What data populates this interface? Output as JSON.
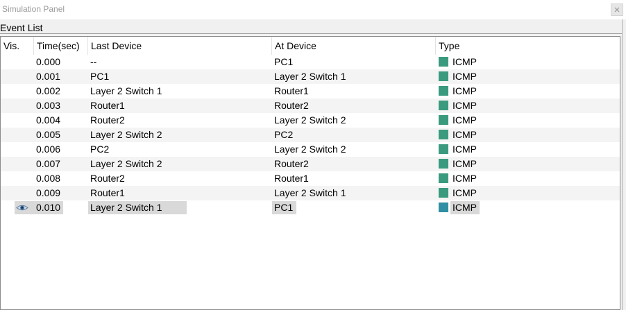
{
  "window": {
    "title": "Simulation Panel",
    "close_icon": "close-icon"
  },
  "event_list": {
    "label": "Event List",
    "columns": [
      "Vis.",
      "Time(sec)",
      "Last Device",
      "At Device",
      "Type"
    ],
    "rows": [
      {
        "time": "0.000",
        "last": "--",
        "at": "PC1",
        "type": "ICMP",
        "color": "#3a9a7e"
      },
      {
        "time": "0.001",
        "last": "PC1",
        "at": "Layer 2 Switch 1",
        "type": "ICMP",
        "color": "#3a9a7e"
      },
      {
        "time": "0.002",
        "last": "Layer 2 Switch 1",
        "at": "Router1",
        "type": "ICMP",
        "color": "#3a9a7e"
      },
      {
        "time": "0.003",
        "last": "Router1",
        "at": "Router2",
        "type": "ICMP",
        "color": "#3a9a7e"
      },
      {
        "time": "0.004",
        "last": "Router2",
        "at": "Layer 2 Switch 2",
        "type": "ICMP",
        "color": "#3a9a7e"
      },
      {
        "time": "0.005",
        "last": "Layer 2 Switch 2",
        "at": "PC2",
        "type": "ICMP",
        "color": "#3a9a7e"
      },
      {
        "time": "0.006",
        "last": "PC2",
        "at": "Layer 2 Switch 2",
        "type": "ICMP",
        "color": "#3a9a7e"
      },
      {
        "time": "0.007",
        "last": "Layer 2 Switch 2",
        "at": "Router2",
        "type": "ICMP",
        "color": "#3a9a7e"
      },
      {
        "time": "0.008",
        "last": "Router2",
        "at": "Router1",
        "type": "ICMP",
        "color": "#3a9a7e"
      },
      {
        "time": "0.009",
        "last": "Router1",
        "at": "Layer 2 Switch 1",
        "type": "ICMP",
        "color": "#3a9a7e"
      },
      {
        "time": "0.010",
        "last": "Layer 2 Switch 1",
        "at": "PC1",
        "type": "ICMP",
        "color": "#2f8fa3",
        "visible_icon": "eye-icon",
        "selected": true
      }
    ]
  }
}
